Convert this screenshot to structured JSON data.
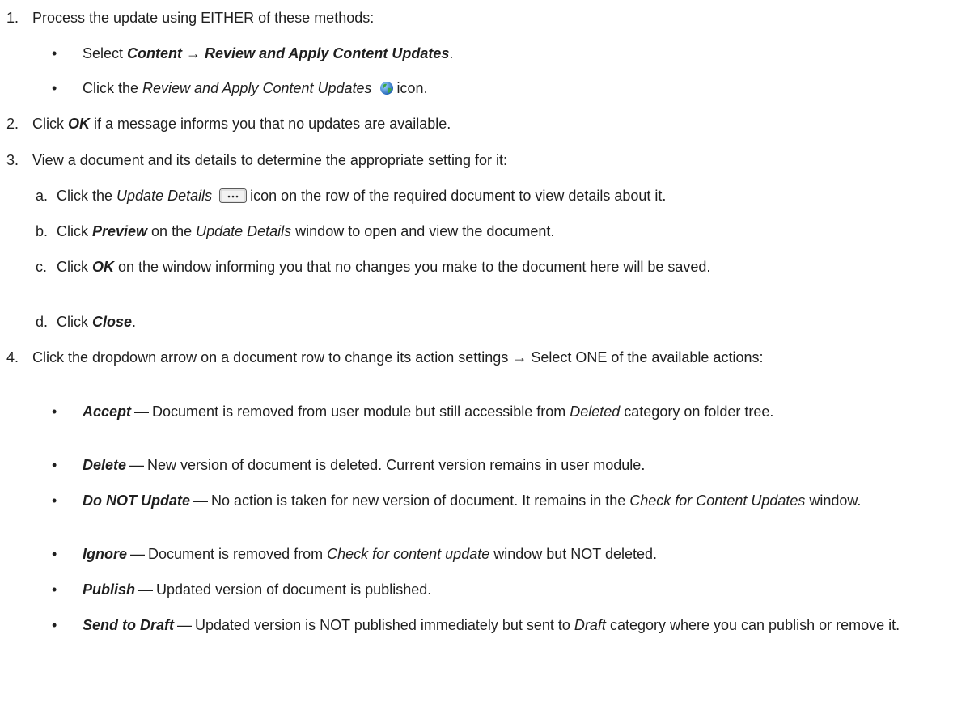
{
  "step1": {
    "number": "1.",
    "text": "Process the update using EITHER of these methods:",
    "bullet_a": {
      "pre": "Select ",
      "t1": "Content",
      "arrow": " → ",
      "t2": "Review and Apply Content Updates",
      "post": "."
    },
    "bullet_b": {
      "pre": "Click the ",
      "t1": "Review and Apply Content Updates",
      "post": "icon.",
      "icon": "globe-icon"
    }
  },
  "step2": {
    "number": "2.",
    "pre": "Click ",
    "t1": "OK",
    "post": " if a message informs you that no updates are available."
  },
  "step3": {
    "number": "3.",
    "text": "View a document and its details to determine the appropriate setting for it:",
    "sub_a": {
      "letter": "a.",
      "pre": "Click the ",
      "t1": "Update Details",
      "post": "icon on the row of the required document to view details about it.",
      "icon": "ellipsis-button-icon"
    },
    "sub_b": {
      "letter": "b.",
      "pre": "Click ",
      "t1": "Preview",
      "mid": " on the ",
      "t2": "Update Details",
      "post": " window to open and view the document."
    },
    "sub_c": {
      "letter": "c.",
      "pre": "Click ",
      "t1": "OK",
      "post": " on the window informing you that no changes you make to the document here will be saved."
    },
    "sub_d": {
      "letter": "d.",
      "pre": "Click ",
      "t1": "Close",
      "post": "."
    }
  },
  "step4": {
    "number": "4.",
    "text": "Click the dropdown arrow on a document row to change its action settings → Select ONE of the available actions:",
    "actions": [
      {
        "name": "Accept",
        "desc_pre": "Document is removed from user module but still accessible from ",
        "desc_it": "Deleted",
        "desc_post": " category on folder tree."
      },
      {
        "name": "Delete",
        "desc_pre": "New version of document is deleted. Current version remains in user module.",
        "desc_it": "",
        "desc_post": ""
      },
      {
        "name": "Do NOT Update",
        "desc_pre": "No action is taken for new version of document. It remains in the ",
        "desc_it": "Check for Content Updates",
        "desc_post": " window."
      },
      {
        "name": "Ignore",
        "desc_pre": "Document is removed from ",
        "desc_it": "Check for content update",
        "desc_post": " window but NOT deleted."
      },
      {
        "name": "Publish",
        "desc_pre": "Updated version of document is published.",
        "desc_it": "",
        "desc_post": ""
      },
      {
        "name": "Send to Draft",
        "desc_pre": "Updated version is NOT published immediately but sent to ",
        "desc_it": "Draft",
        "desc_post": " category where you can publish or remove it."
      }
    ]
  },
  "dash": "—",
  "bullet_char": "•"
}
